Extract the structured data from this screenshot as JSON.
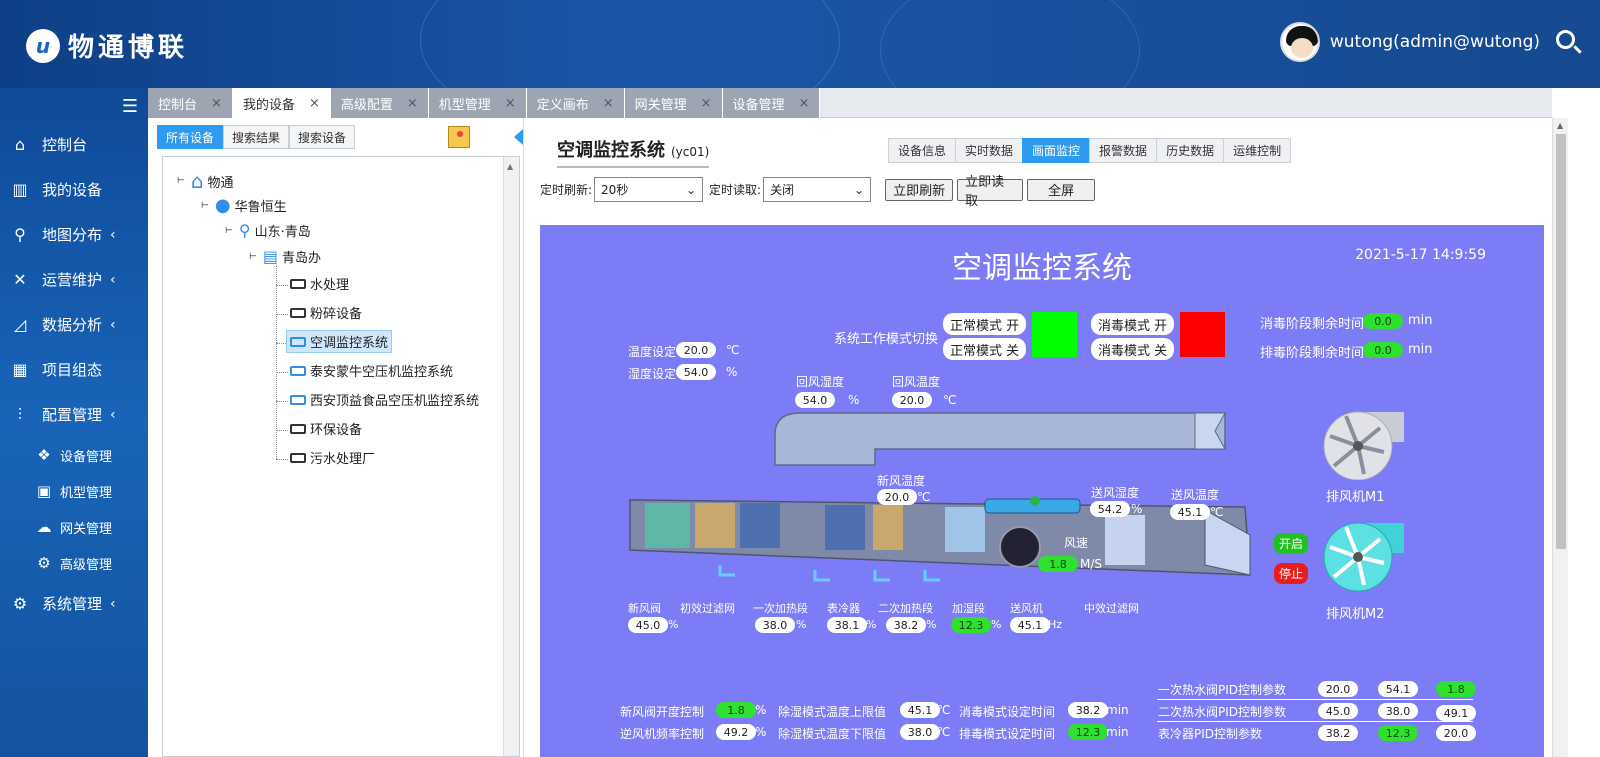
{
  "app": {
    "logo_mark": "u",
    "logo_text": "物通博联",
    "user": "wutong(admin@wutong)"
  },
  "sidebar": {
    "items": [
      {
        "label": "控制台",
        "icon": "home-icon"
      },
      {
        "label": "我的设备",
        "icon": "books-icon"
      },
      {
        "label": "地图分布",
        "icon": "map-pin-icon",
        "arrow": "‹"
      },
      {
        "label": "运营维护",
        "icon": "tools-icon",
        "arrow": "‹"
      },
      {
        "label": "数据分析",
        "icon": "chart-icon",
        "arrow": "‹"
      },
      {
        "label": "项目组态",
        "icon": "grid-icon"
      },
      {
        "label": "配置管理",
        "icon": "sliders-icon",
        "arrow": "‹"
      },
      {
        "label": "设备管理",
        "icon": "cubes-icon"
      },
      {
        "label": "机型管理",
        "icon": "frame-icon"
      },
      {
        "label": "网关管理",
        "icon": "cloud-icon"
      },
      {
        "label": "高级管理",
        "icon": "gears-icon"
      },
      {
        "label": "系统管理",
        "icon": "gear-icon",
        "arrow": "‹"
      }
    ]
  },
  "tabs": [
    "控制台",
    "我的设备",
    "高级配置",
    "机型管理",
    "定义画布",
    "网关管理",
    "设备管理"
  ],
  "tab_close": "×",
  "left": {
    "subtabs": [
      "所有设备",
      "搜索结果",
      "搜索设备"
    ],
    "tree": [
      "物通",
      "华鲁恒生",
      "山东·青岛",
      "青岛办",
      "水处理",
      "粉碎设备",
      "空调监控系统",
      "泰安蒙牛空压机监控系统",
      "西安顶益食品空压机监控系统",
      "环保设备",
      "污水处理厂"
    ]
  },
  "main": {
    "title": "空调监控系统",
    "code": "(yc01)",
    "tabs": [
      "设备信息",
      "实时数据",
      "画面监控",
      "报警数据",
      "历史数据",
      "运维控制"
    ],
    "refresh_label": "定时刷新:",
    "refresh_value": "20秒",
    "read_label": "定时读取:",
    "read_value": "关闭",
    "btn_refresh": "立即刷新",
    "btn_read": "立即读取",
    "btn_full": "全屏"
  },
  "scada": {
    "title": "空调监控系统",
    "time": "2021-5-17 14:9:59",
    "mode_switch": "系统工作模式切换",
    "normal_on": "正常模式 开",
    "normal_off": "正常模式 关",
    "disinfect_on": "消毒模式 开",
    "disinfect_off": "消毒模式 关",
    "normal_color": "#00ff00",
    "disinfect_color": "#ff0000",
    "disinfect_remain": {
      "label": "消毒阶段剩余时间",
      "value": "0.0",
      "unit": "min"
    },
    "exhaust_remain": {
      "label": "排毒阶段剩余时间",
      "value": "0.0",
      "unit": "min"
    },
    "temp_set": {
      "label": "温度设定",
      "value": "20.0",
      "unit": "℃"
    },
    "hum_set": {
      "label": "湿度设定",
      "value": "54.0",
      "unit": "%"
    },
    "return_hum": {
      "label": "回风湿度",
      "value": "54.0",
      "unit": "%"
    },
    "return_temp": {
      "label": "回风温度",
      "value": "20.0",
      "unit": "℃"
    },
    "fresh_temp": {
      "label": "新风温度",
      "value": "20.0",
      "unit": "℃"
    },
    "supply_hum": {
      "label": "送风湿度",
      "value": "54.2",
      "unit": "%"
    },
    "supply_temp": {
      "label": "送风温度",
      "value": "45.1",
      "unit": "℃"
    },
    "wind": {
      "label": "风速",
      "value": "1.8",
      "unit": "M/S"
    },
    "fan1": "排风机M1",
    "fan2": "排风机M2",
    "start": "开启",
    "stop": "停止",
    "sections": [
      {
        "label": "新风阀",
        "value": "45.0",
        "unit": "%",
        "green": false
      },
      {
        "label": "初效过滤网",
        "value": "",
        "unit": "",
        "green": false
      },
      {
        "label": "一次加热段",
        "value": "38.0",
        "unit": "%",
        "green": false
      },
      {
        "label": "表冷器",
        "value": "38.1",
        "unit": "%",
        "green": false
      },
      {
        "label": "二次加热段",
        "value": "38.2",
        "unit": "%",
        "green": false
      },
      {
        "label": "加湿段",
        "value": "12.3",
        "unit": "%",
        "green": true
      },
      {
        "label": "送风机",
        "value": "45.1",
        "unit": "Hz",
        "green": false
      },
      {
        "label": "中效过滤网",
        "value": "",
        "unit": "",
        "green": false
      }
    ],
    "bottom": {
      "c1": [
        {
          "label": "新风阀开度控制",
          "value": "1.8",
          "unit": "%",
          "green": true
        },
        {
          "label": "逆风机频率控制",
          "value": "49.2",
          "unit": "%",
          "green": false
        }
      ],
      "c2": [
        {
          "label": "除湿模式温度上限值",
          "value": "45.1",
          "unit": "℃",
          "green": false
        },
        {
          "label": "除湿模式温度下限值",
          "value": "38.0",
          "unit": "℃",
          "green": false
        }
      ],
      "c3": [
        {
          "label": "消毒模式设定时间",
          "value": "38.2",
          "unit": "min",
          "green": false
        },
        {
          "label": "排毒模式设定时间",
          "value": "12.3",
          "unit": "min",
          "green": true
        }
      ],
      "pid": [
        {
          "label": "一次热水阀PID控制参数",
          "v": [
            "20.0",
            "54.1",
            "1.8"
          ],
          "g": [
            false,
            false,
            true
          ]
        },
        {
          "label": "二次热水阀PID控制参数",
          "v": [
            "45.0",
            "38.0",
            "49.1"
          ],
          "g": [
            false,
            false,
            false
          ]
        },
        {
          "label": "表冷器PID控制参数",
          "v": [
            "38.2",
            "12.3",
            "20.0"
          ],
          "g": [
            false,
            true,
            false
          ]
        }
      ]
    }
  }
}
